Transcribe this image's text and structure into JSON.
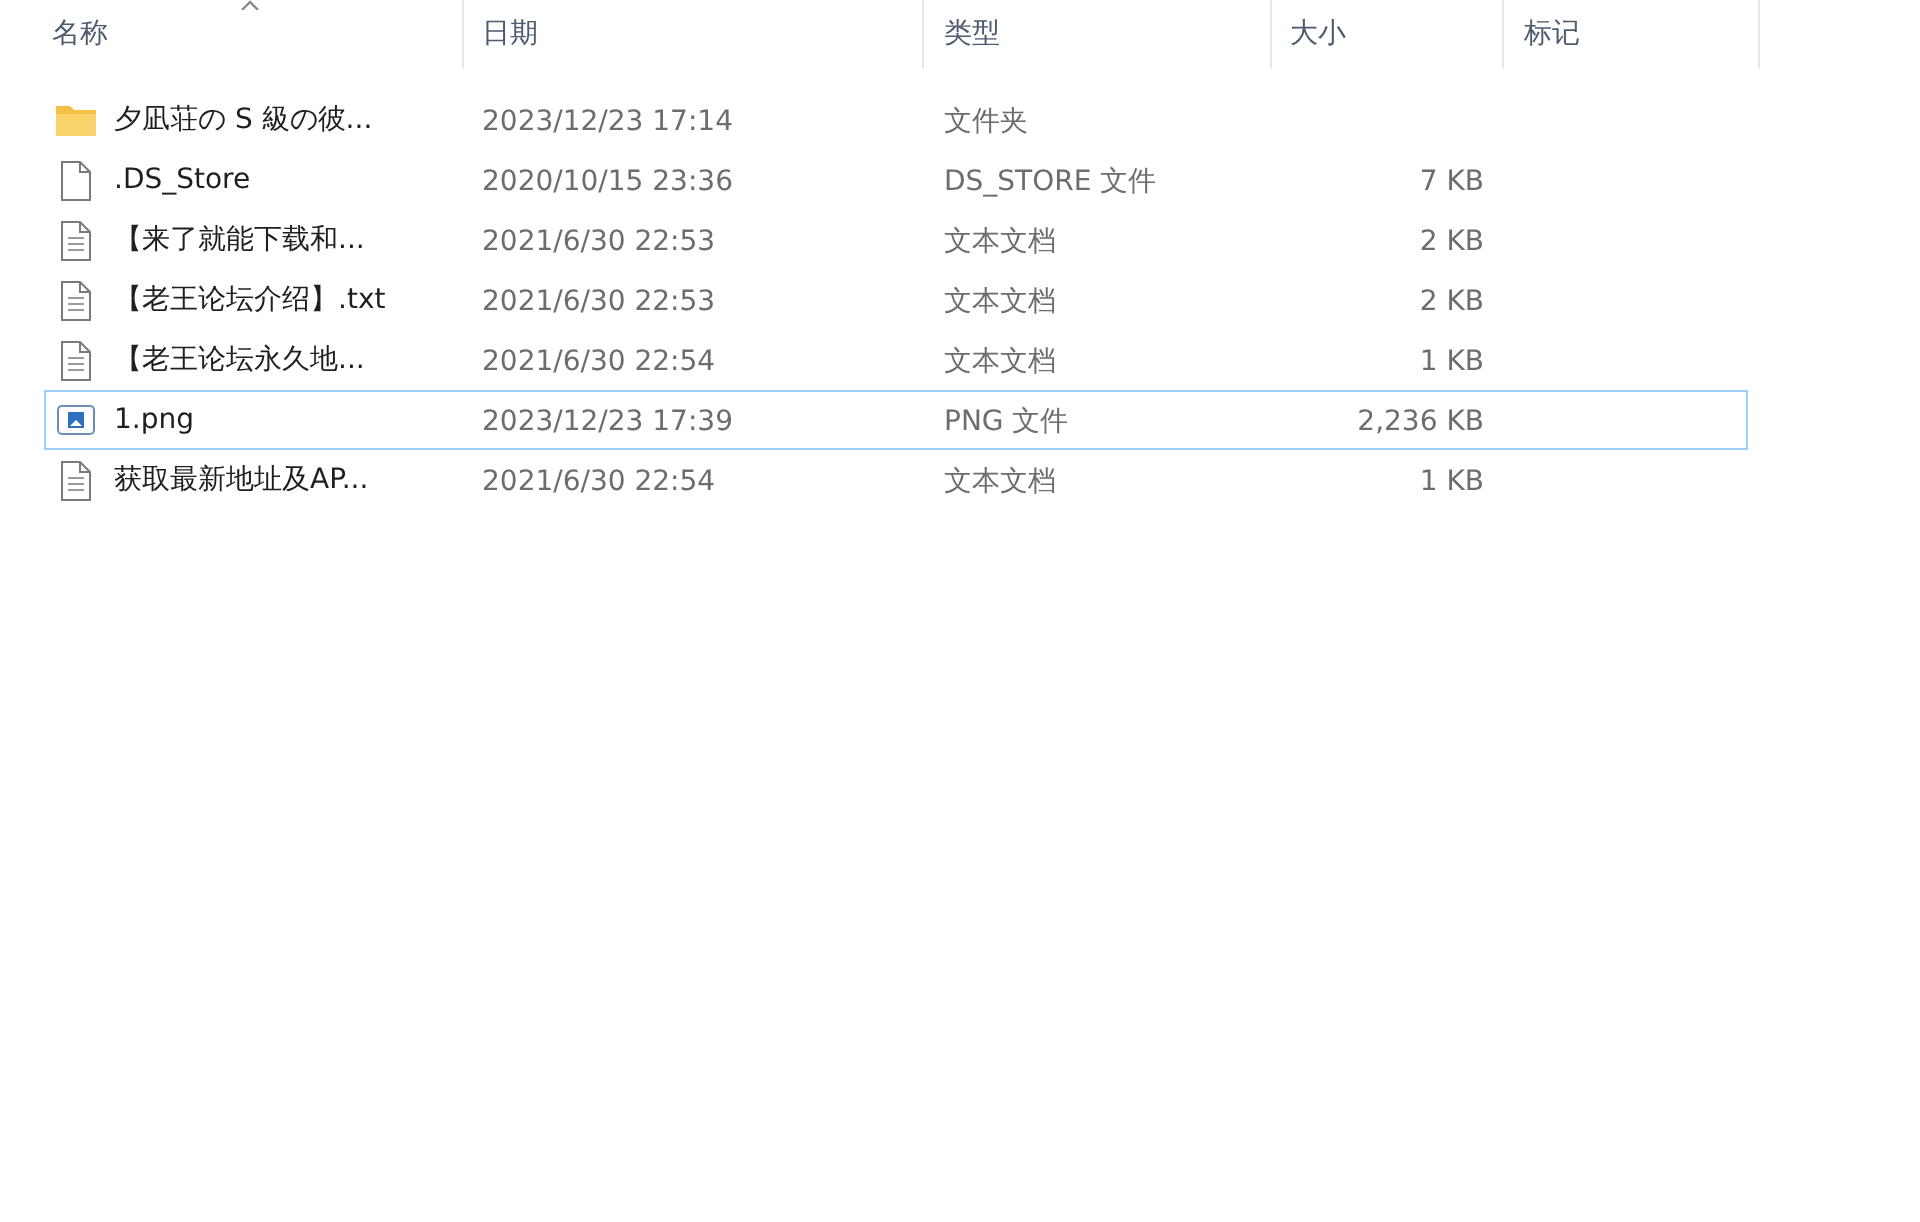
{
  "columns": [
    {
      "label": "名称",
      "sorted": true
    },
    {
      "label": "日期",
      "sorted": false
    },
    {
      "label": "类型",
      "sorted": false
    },
    {
      "label": "大小",
      "sorted": false
    },
    {
      "label": "标记",
      "sorted": false
    }
  ],
  "rows": [
    {
      "kind": "folder",
      "name": "夕凪荘の S 級の彼...",
      "date": "2023/12/23 17:14",
      "type": "文件夹",
      "selected": false
    },
    {
      "kind": "file",
      "name": ".DS_Store",
      "date": "2020/10/15 23:36",
      "type": "DS_STORE 文件",
      "size": "7 KB",
      "selected": false
    },
    {
      "kind": "text",
      "name": "【来了就能下载和...",
      "date": "2021/6/30 22:53",
      "type": "文本文档",
      "size": "2 KB",
      "selected": false
    },
    {
      "kind": "text",
      "name": "【老王论坛介绍】.txt",
      "date": "2021/6/30 22:53",
      "type": "文本文档",
      "size": "2 KB",
      "selected": false
    },
    {
      "kind": "text",
      "name": "【老王论坛永久地...",
      "date": "2021/6/30 22:54",
      "type": "文本文档",
      "size": "1 KB",
      "selected": false
    },
    {
      "kind": "image",
      "name": "1.png",
      "date": "2023/12/23 17:39",
      "type": "PNG 文件",
      "size": "2,236 KB",
      "selected": true
    },
    {
      "kind": "text",
      "name": "获取最新地址及AP...",
      "date": "2021/6/30 22:54",
      "type": "文本文档",
      "size": "1 KB",
      "selected": false
    }
  ]
}
